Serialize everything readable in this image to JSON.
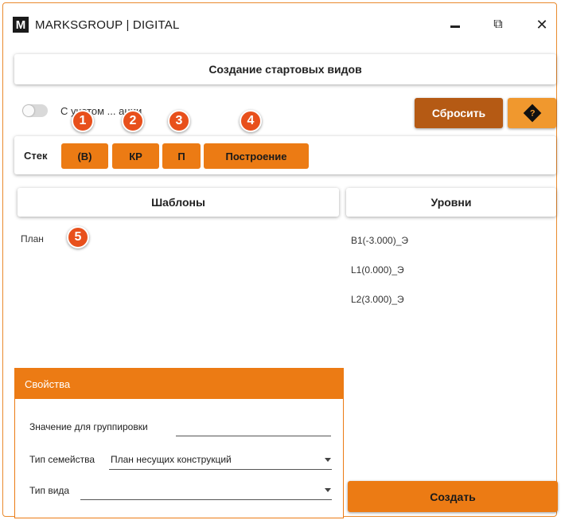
{
  "window": {
    "logo_letter": "M",
    "title": "MARKSGROUP | DIGITAL",
    "close_glyph": "✕",
    "restore_glyph": "⧉"
  },
  "header": {
    "title": "Создание стартовых видов"
  },
  "toggle": {
    "label": "С учетом ... ации",
    "checked": false
  },
  "buttons": {
    "reset": "Сбросить",
    "help_glyph": "?",
    "create": "Создать"
  },
  "stack": {
    "label": "Стек",
    "items": [
      {
        "label": "(В)",
        "badge": "1"
      },
      {
        "label": "КР",
        "badge": "2"
      },
      {
        "label": "П",
        "badge": "3"
      },
      {
        "label": "Построение",
        "badge": "4"
      }
    ]
  },
  "templates": {
    "header": "Шаблоны",
    "items": [
      "План"
    ],
    "badge": "5"
  },
  "levels": {
    "header": "Уровни",
    "items": [
      "B1(-3.000)_Э",
      "L1(0.000)_Э",
      "L2(3.000)_Э"
    ]
  },
  "properties": {
    "header": "Свойства",
    "fields": [
      {
        "label": "Значение для группировки",
        "value": ""
      },
      {
        "label": "Тип семейства",
        "value": "План несущих конструкций"
      },
      {
        "label": "Тип вида",
        "value": ""
      }
    ]
  },
  "colors": {
    "accent": "#ec7b14",
    "reset": "#b55a14",
    "help": "#f0982e",
    "badge": "#e8501c",
    "border": "#e98a2e"
  },
  "icons": {
    "minimize": "minimize-icon",
    "restore": "restore-icon",
    "close": "close-icon",
    "help": "help-diamond-icon",
    "dropdown": "chevron-down-icon"
  }
}
